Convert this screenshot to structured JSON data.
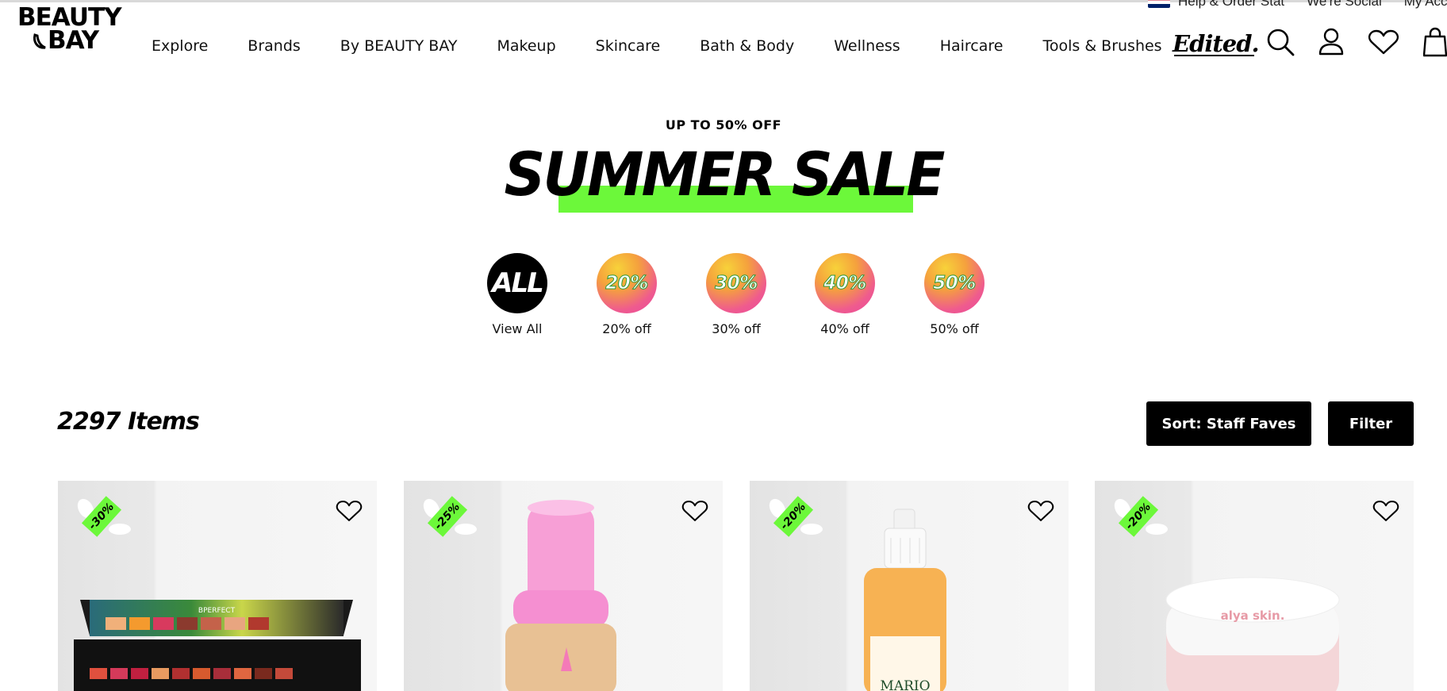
{
  "utility_bar": {
    "help": "Help & Order Stat",
    "social": "We're Social",
    "account": "My Acco"
  },
  "header": {
    "logo_line1": "BEAUTY",
    "logo_line2": "BAY",
    "nav": [
      "Explore",
      "Brands",
      "By BEAUTY BAY",
      "Makeup",
      "Skincare",
      "Bath & Body",
      "Wellness",
      "Haircare",
      "Tools & Brushes"
    ],
    "edited_label": "Edited."
  },
  "promo": {
    "subtitle": "UP TO 50% OFF",
    "title": "SUMMER SALE"
  },
  "discount_circles": [
    {
      "badge": "ALL",
      "label": "View All"
    },
    {
      "badge": "20%",
      "label": "20% off"
    },
    {
      "badge": "30%",
      "label": "30% off"
    },
    {
      "badge": "40%",
      "label": "40% off"
    },
    {
      "badge": "50%",
      "label": "50% off"
    }
  ],
  "listing": {
    "count": "2297 Items",
    "sort_label": "Sort: Staff Faves",
    "filter_label": "Filter"
  },
  "products": [
    {
      "discount": "-30%",
      "brand_mark": "BPERFECT"
    },
    {
      "discount": "-25%",
      "brand_mark": ""
    },
    {
      "discount": "-20%",
      "brand_mark": "MARIO"
    },
    {
      "discount": "-20%",
      "brand_mark": "alya skin."
    }
  ],
  "colors": {
    "accent_green": "#6cf83a",
    "black": "#000000"
  }
}
